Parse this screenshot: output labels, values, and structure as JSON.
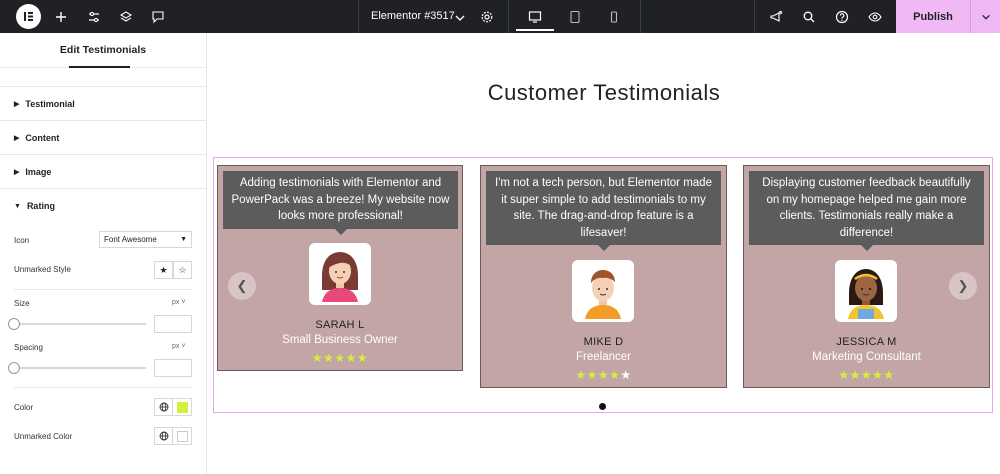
{
  "topbar": {
    "document_title": "Elementor #3517",
    "publish_label": "Publish"
  },
  "panel": {
    "title": "Edit Testimonials",
    "sections": [
      "Testimonial",
      "Content",
      "Image",
      "Rating"
    ],
    "rating": {
      "icon_label": "Icon",
      "icon_value": "Font Awesome",
      "unmarked_style_label": "Unmarked Style",
      "size_label": "Size",
      "size_unit": "px",
      "spacing_label": "Spacing",
      "spacing_unit": "px",
      "color_label": "Color",
      "color_value": "#d6f03a",
      "unmarked_color_label": "Unmarked Color",
      "unmarked_color_value": "#ffffff"
    }
  },
  "canvas": {
    "heading": "Customer Testimonials",
    "testimonials": [
      {
        "quote": "Adding testimonials with Elementor and PowerPack was a breeze! My website now looks more professional!",
        "name": "SARAH L",
        "role": "Small Business Owner",
        "rating": 5
      },
      {
        "quote": "I'm not a tech person, but Elementor made it super simple to add testimonials to my site. The drag-and-drop feature is a lifesaver!",
        "name": "MIKE D",
        "role": "Freelancer",
        "rating": 4.5
      },
      {
        "quote": "Displaying customer feedback beautifully on my homepage helped me gain more clients. Testimonials really make a difference!",
        "name": "JESSICA M",
        "role": "Marketing Consultant",
        "rating": 5
      }
    ],
    "card_color": "#c3a5a5",
    "bubble_color": "#5c5c5c",
    "star_color": "#d6f03a"
  }
}
